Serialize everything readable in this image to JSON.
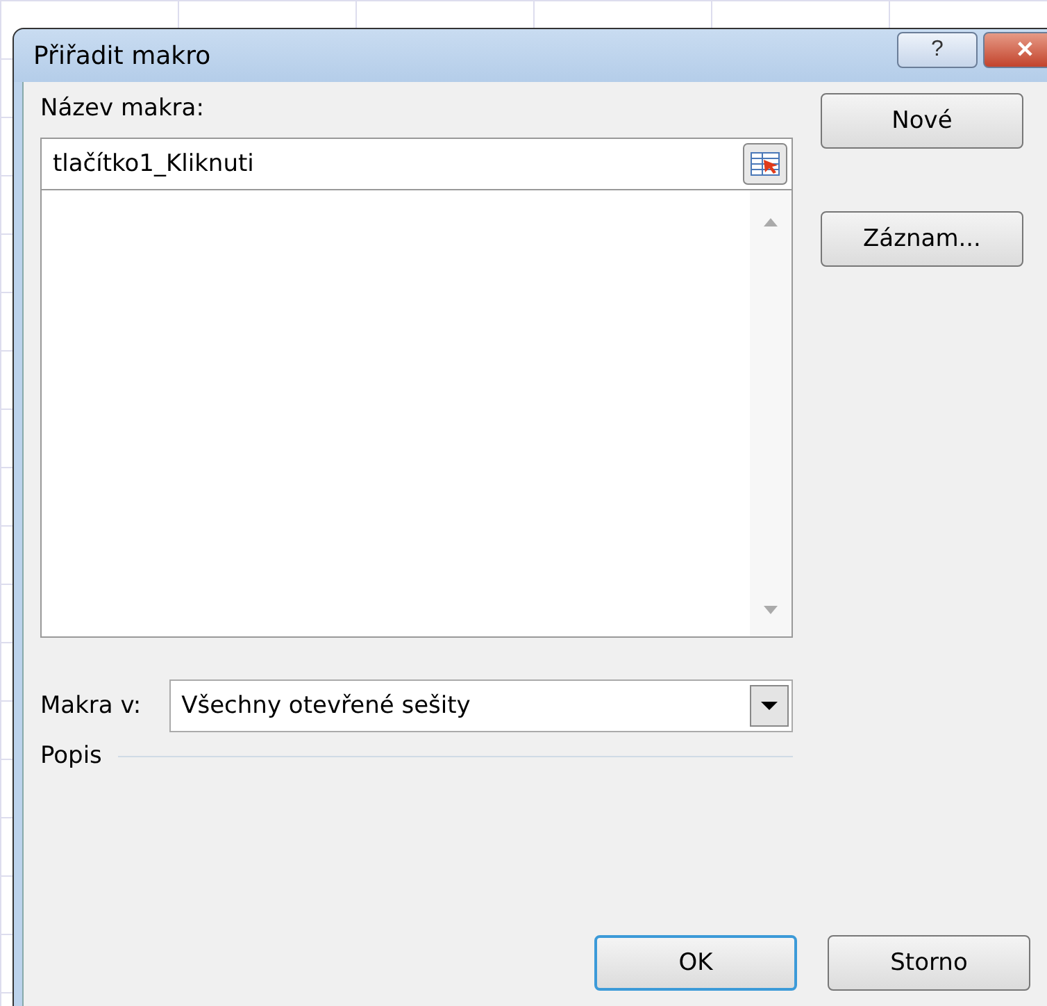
{
  "window": {
    "title": "Přiřadit makro",
    "title_buttons": [
      {
        "kind": "help",
        "label": "?"
      },
      {
        "kind": "close",
        "label": "✕"
      }
    ]
  },
  "macro_name": {
    "label": "Název makra:",
    "value": "tlačítko1_Kliknuti"
  },
  "side_buttons": [
    "Nové",
    "Záznam..."
  ],
  "macros_in": {
    "label": "Makra v:",
    "value": "Všechny otevřené sešity"
  },
  "description": {
    "label": "Popis"
  },
  "buttons": [
    {
      "label": "OK",
      "default": true
    },
    {
      "label": "Storno",
      "default": false
    }
  ]
}
